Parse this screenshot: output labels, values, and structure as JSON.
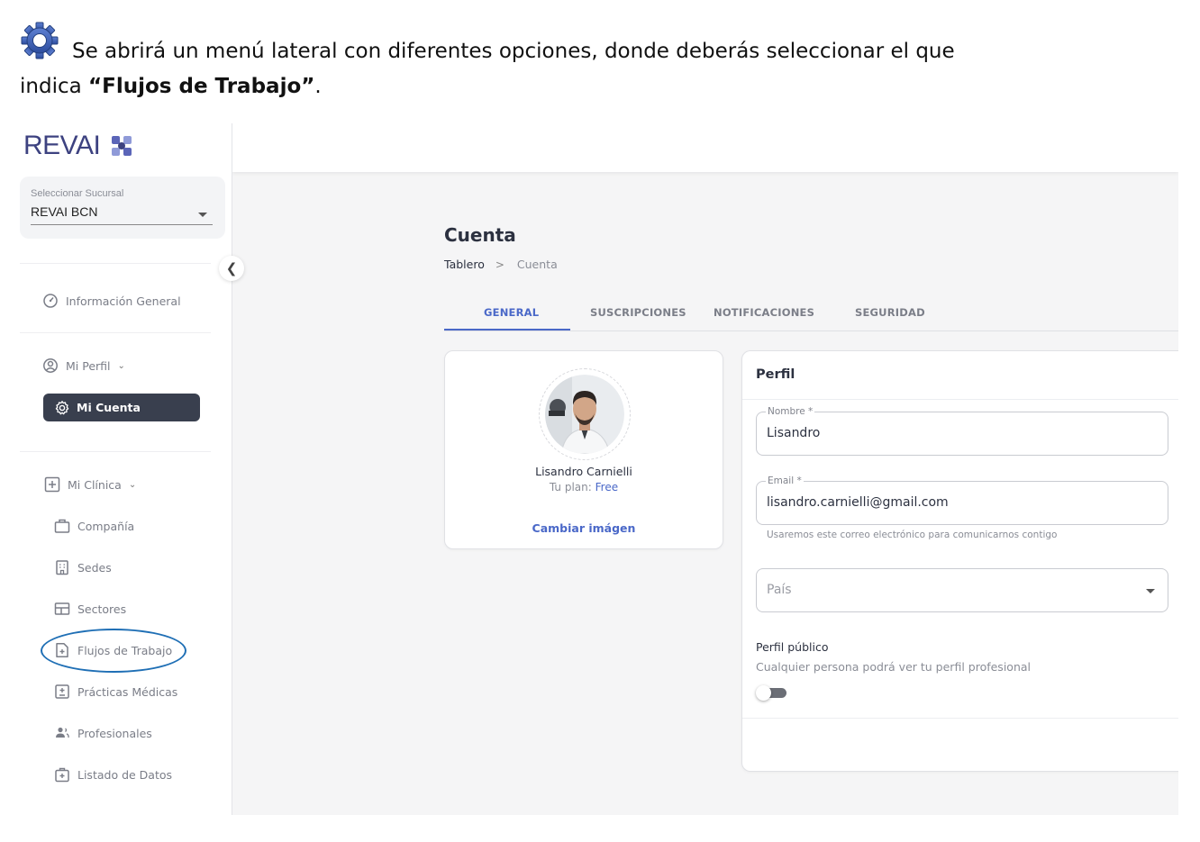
{
  "doc": {
    "icon": "gear-icon",
    "line1": "Se abrirá un menú lateral con diferentes opciones, donde deberás seleccionar el que",
    "line2_prefix": "indica ",
    "line2_bold": "“Flujos de Trabajo”",
    "line2_suffix": "."
  },
  "app": {
    "logo_text": "REVAI",
    "branch": {
      "label": "Seleccionar Sucursal",
      "value": "REVAI BCN"
    },
    "sidebar": {
      "general_info": "Información General",
      "my_profile": "Mi Perfil",
      "my_account": "Mi Cuenta",
      "my_clinic": "Mi Clínica",
      "company": "Compañía",
      "sites": "Sedes",
      "sectors": "Sectores",
      "workflows": "Flujos de Trabajo",
      "medical_practices": "Prácticas Médicas",
      "professionals": "Profesionales",
      "data_list": "Listado de Datos"
    },
    "page": {
      "title": "Cuenta",
      "breadcrumb": {
        "home": "Tablero",
        "separator": ">",
        "current": "Cuenta"
      },
      "tabs": [
        "GENERAL",
        "SUSCRIPCIONES",
        "NOTIFICACIONES",
        "SEGURIDAD"
      ]
    },
    "user_card": {
      "name": "Lisandro Carnielli",
      "plan_label": "Tu plan:",
      "plan_value": "Free",
      "change_image": "Cambiar imágen"
    },
    "profile": {
      "title": "Perfil",
      "name_label": "Nombre *",
      "name_value": "Lisandro",
      "email_label": "Email *",
      "email_value": "lisandro.carnielli@gmail.com",
      "email_helper": "Usaremos este correo electrónico para comunicarnos contigo",
      "country_placeholder": "País",
      "public_title": "Perfil público",
      "public_desc": "Cualquier persona podrá ver tu perfil profesional",
      "public_enabled": false
    },
    "colors": {
      "accent": "#4a68c8",
      "active_nav": "#393f4e",
      "ellipse": "#1f6fb5",
      "logo": "#3d4280"
    }
  }
}
